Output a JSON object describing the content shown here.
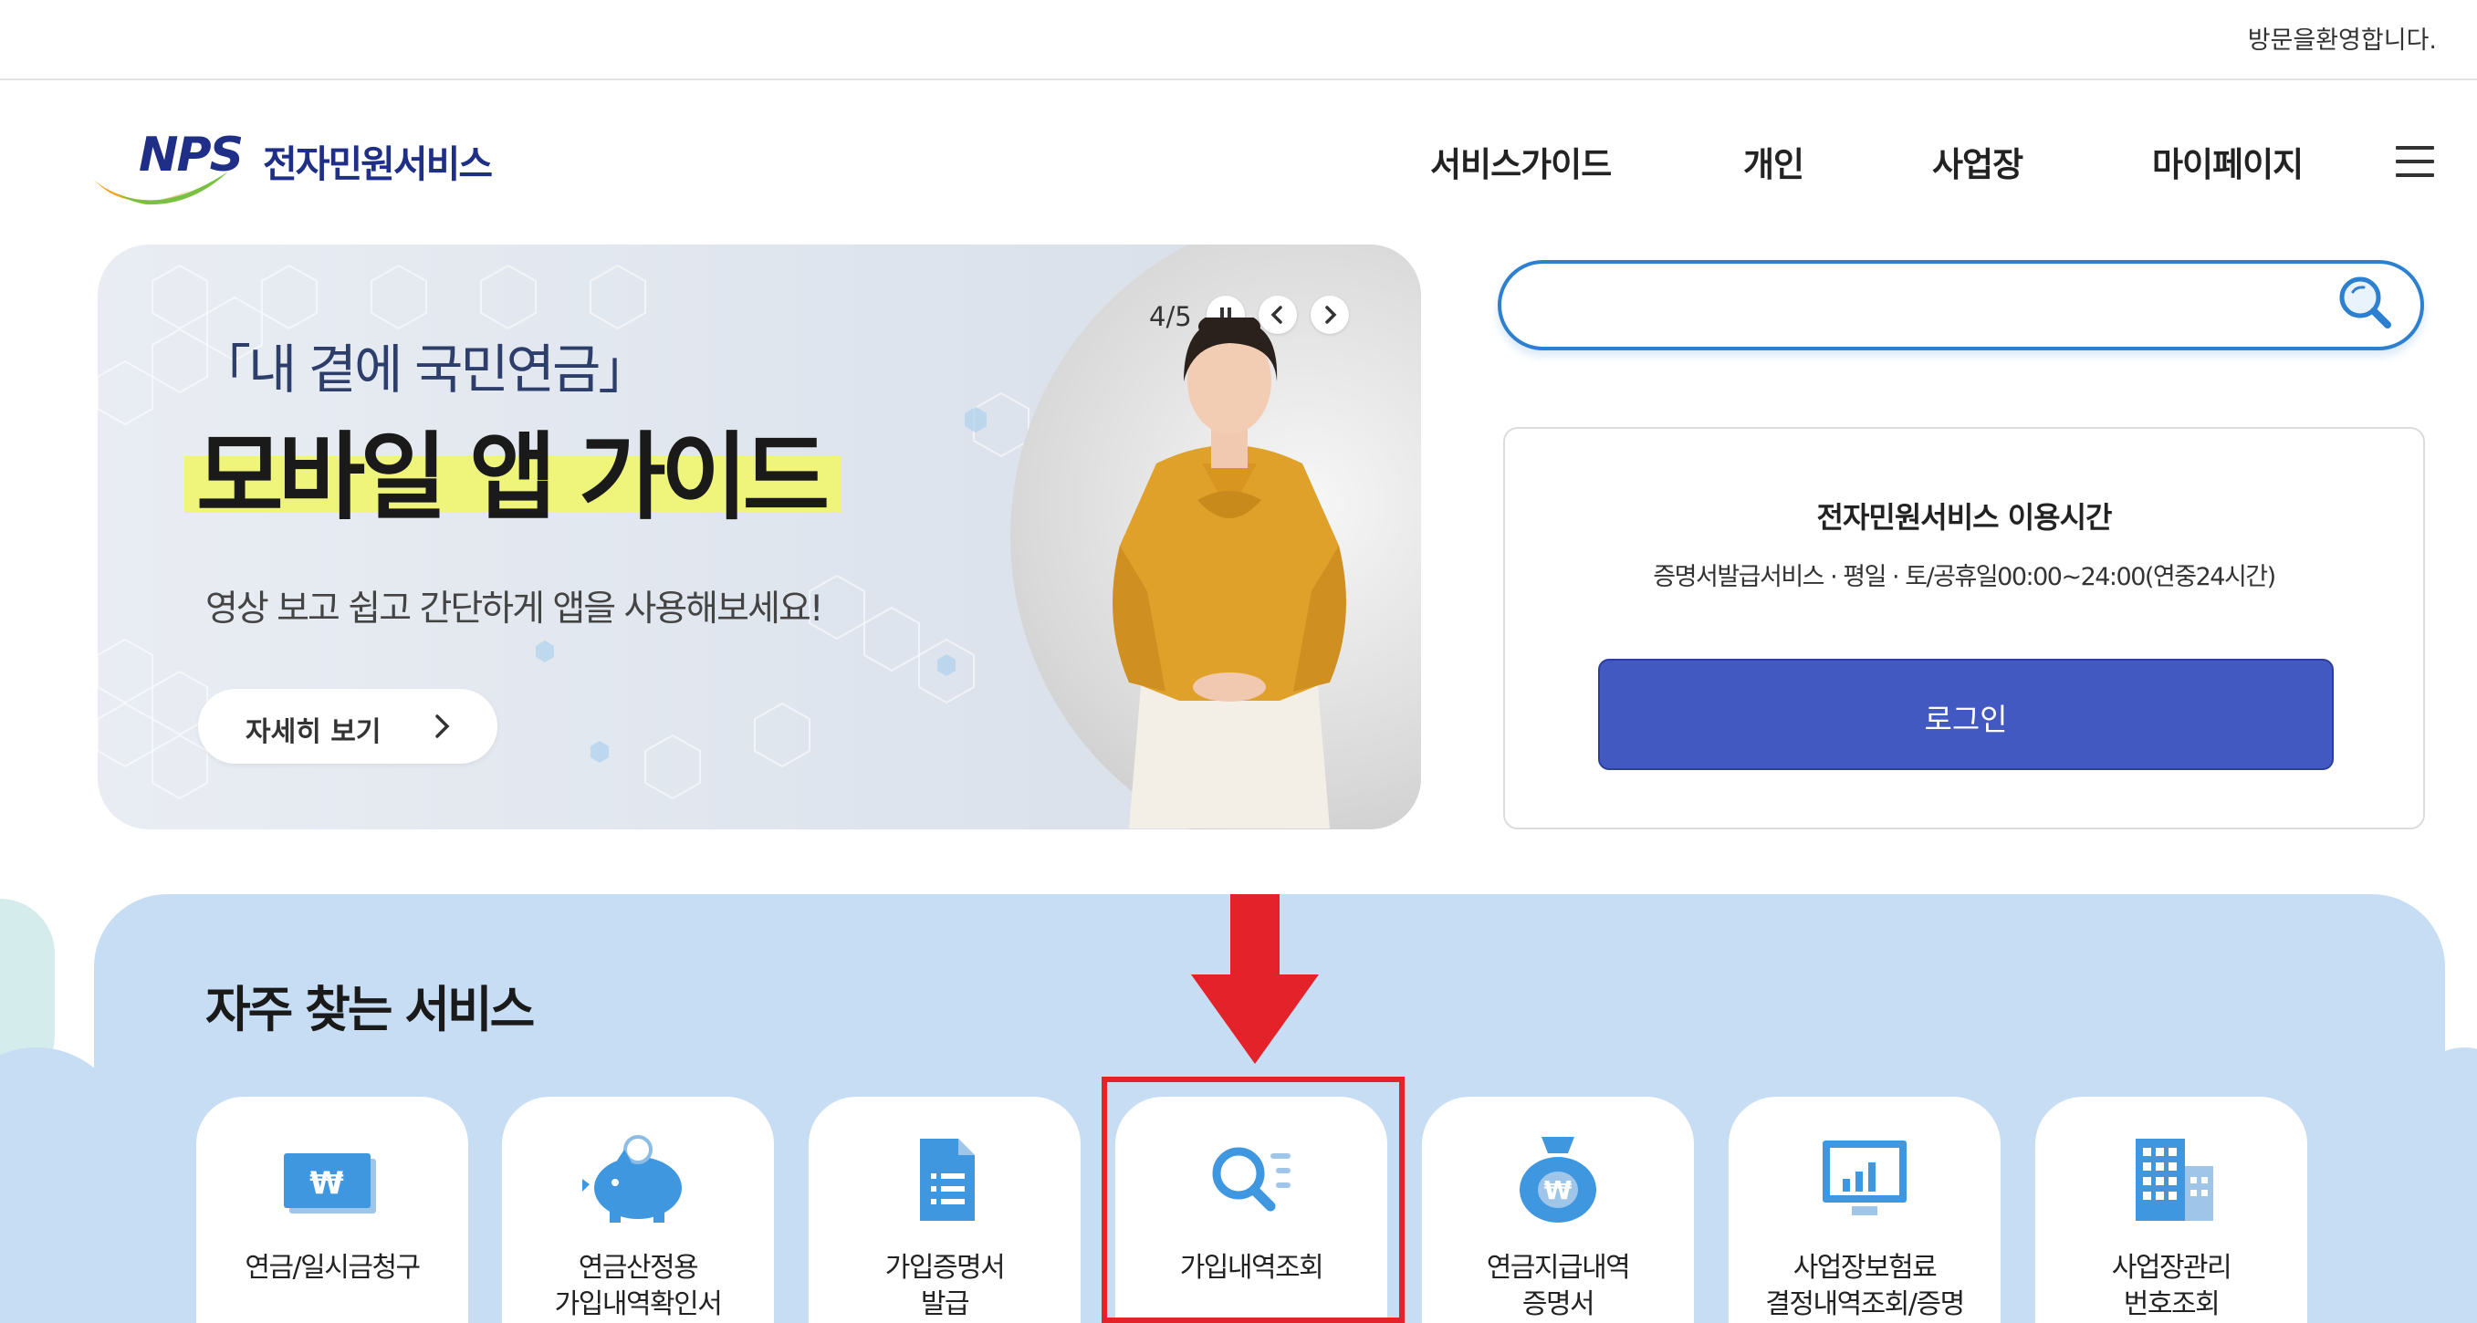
{
  "topbar": {
    "welcome": "방문을환영합니다."
  },
  "header": {
    "logo_abbr": "NPS",
    "logo_title": "전자민원서비스",
    "nav": [
      "서비스가이드",
      "개인",
      "사업장",
      "마이페이지"
    ],
    "menu_icon": "hamburger-menu-icon"
  },
  "banner": {
    "subtitle": "「내 곁에 국민연금」",
    "title": "모바일 앱 가이드",
    "description": "영상 보고 쉽고 간단하게 앱을 사용해보세요!",
    "button_label": "자세히 보기",
    "counter": "4/5",
    "icons": [
      "pause-icon",
      "prev-icon",
      "next-icon",
      "chevron-right-icon"
    ]
  },
  "search": {
    "placeholder": "",
    "icon": "search-icon"
  },
  "service_info": {
    "title": "전자민원서비스 이용시간",
    "hours": "증명서발급서비스 · 평일 · 토/공휴일00:00~24:00(연중24시간)",
    "login_label": "로그인"
  },
  "frequent": {
    "title": "자주 찾는 서비스",
    "items": [
      {
        "label": "연금/일시금청구",
        "icon": "won-bill-icon"
      },
      {
        "label": "연금산정용\n가입내역확인서",
        "icon": "piggy-bank-icon"
      },
      {
        "label": "가입증명서\n발급",
        "icon": "document-icon"
      },
      {
        "label": "가입내역조회",
        "icon": "search-list-icon"
      },
      {
        "label": "연금지급내역\n증명서",
        "icon": "money-bag-icon"
      },
      {
        "label": "사업장보험료\n결정내역조회/증명",
        "icon": "monitor-chart-icon"
      },
      {
        "label": "사업장관리\n번호조회",
        "icon": "building-icon"
      }
    ],
    "highlight_color": "#e4222a"
  },
  "colors": {
    "brand_navy": "#1f2e86",
    "accent_blue": "#2d7fd0",
    "login_blue": "#4259c2",
    "services_bg": "#c6ddf4",
    "highlight_red": "#e4222a"
  }
}
